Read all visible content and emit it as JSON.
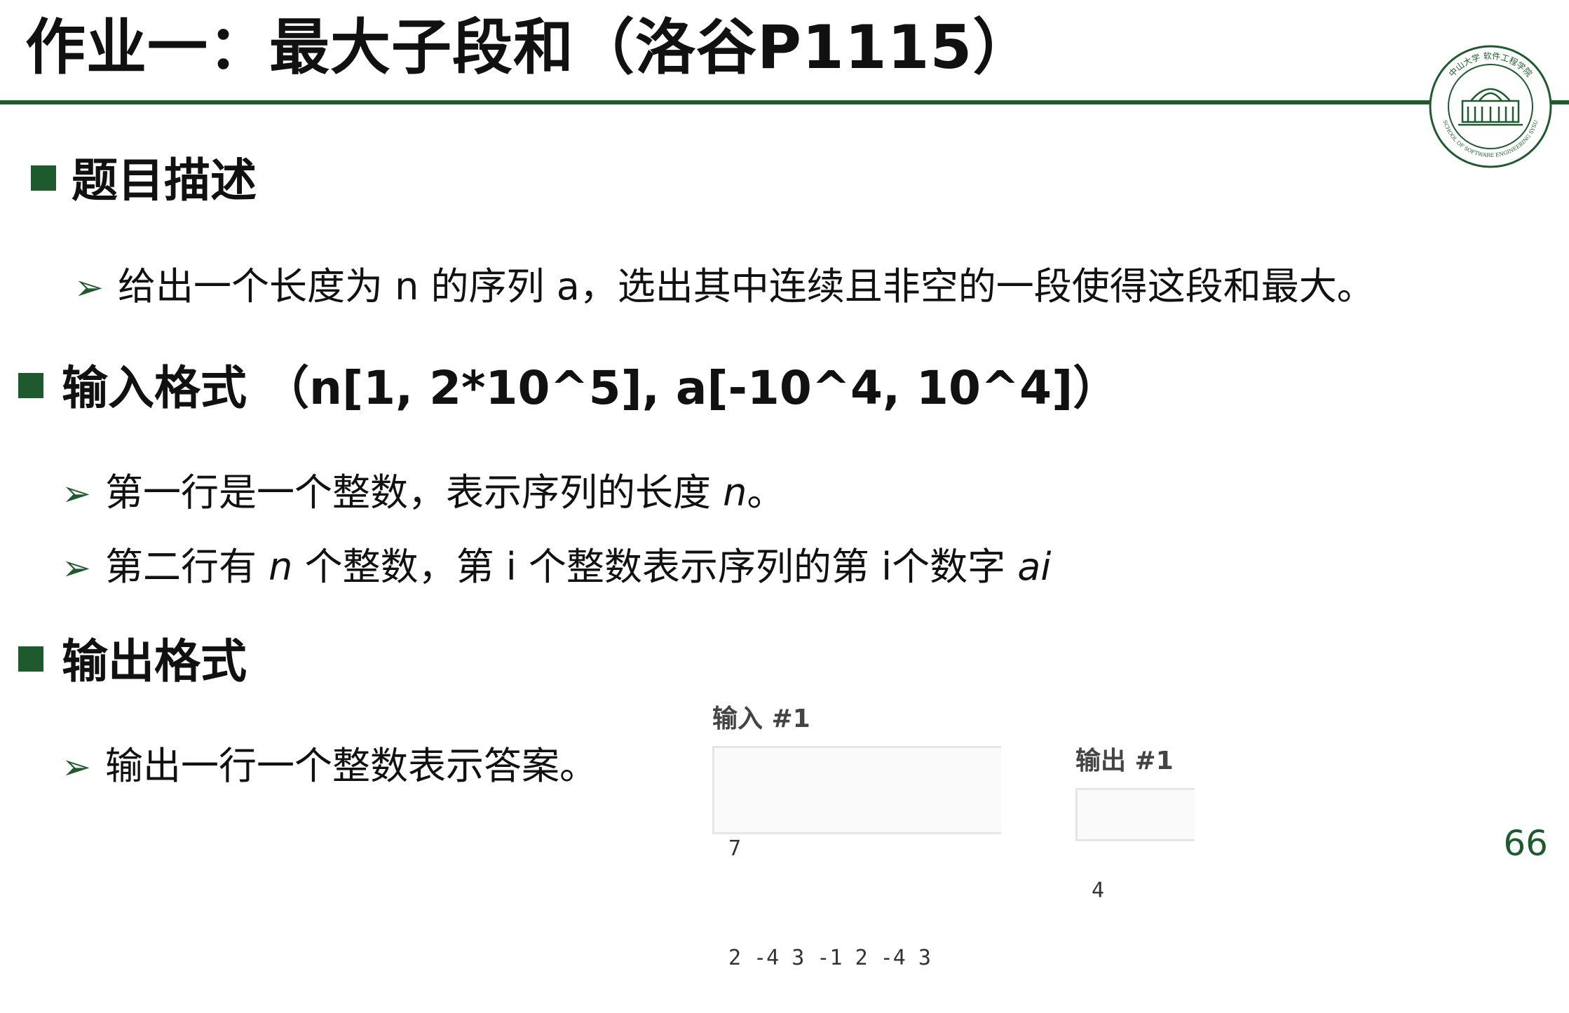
{
  "slide": {
    "title": "作业一：最大子段和（洛谷P1115）",
    "page_number": "66"
  },
  "logo": {
    "ring_text": "中山大学 软件工程学院",
    "ring_text_bottom": "SCHOOL OF SOFTWARE ENGINEERING SYSU"
  },
  "sections": {
    "description": {
      "heading": "题目描述",
      "bullet1": "给出一个长度为 n 的序列 a，选出其中连续且非空的一段使得这段和最大。"
    },
    "input": {
      "heading": "输入格式 （n[1, 2*10^5], a[-10^4, 10^4]）",
      "bullet1_pre": "第一行是一个整数，表示序列的长度 ",
      "bullet1_var": "n",
      "bullet1_post": "。",
      "bullet2_pre": "第二行有 ",
      "bullet2_var": "n",
      "bullet2_mid": " 个整数，第 i 个整数表示序列的第 i个数字 ",
      "bullet2_var2": "ai"
    },
    "output": {
      "heading": "输出格式",
      "bullet1": "输出一行一个整数表示答案。"
    }
  },
  "sample": {
    "input_label": "输入 #1",
    "input_line1": "7",
    "input_line2": "2 -4 3 -1 2 -4 3",
    "output_label": "输出 #1",
    "output_line1": "4"
  },
  "colors": {
    "accent": "#1f5a2e"
  }
}
